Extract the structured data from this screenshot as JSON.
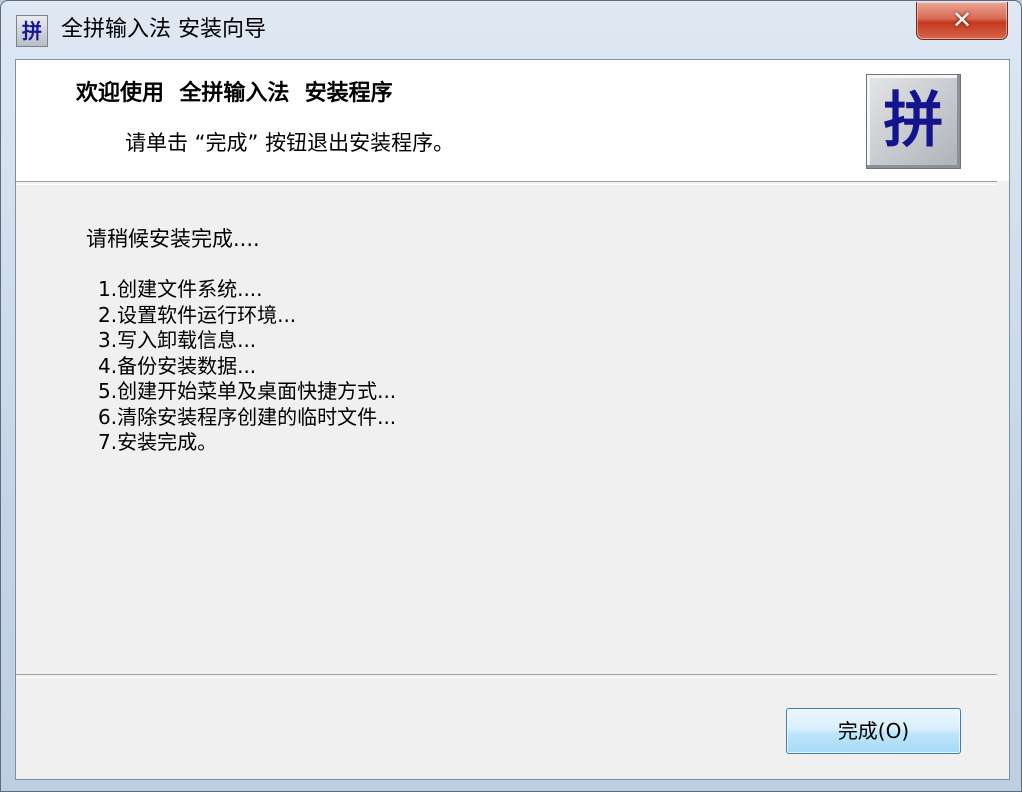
{
  "window": {
    "title": "全拼输入法 安装向导",
    "icon_glyph": "拼",
    "close_glyph": "✕"
  },
  "header": {
    "title": "欢迎使用  全拼输入法  安装程序",
    "subtitle": "请单击 “完成” 按钮退出安装程序。",
    "logo_glyph": "拼"
  },
  "content": {
    "status": "请稍候安装完成....",
    "steps": [
      "1.创建文件系统....",
      "2.设置软件运行环境...",
      "3.写入卸载信息...",
      "4.备份安装数据...",
      "5.创建开始菜单及桌面快捷方式...",
      "6.清除安装程序创建的临时文件...",
      "7.安装完成。"
    ]
  },
  "footer": {
    "finish_label": "完成(O)"
  },
  "colors": {
    "logo_glyph": "#14148f",
    "button_border": "#3c7fb1",
    "close_button": "#c4391f",
    "client_background": "#f0f0f0"
  }
}
